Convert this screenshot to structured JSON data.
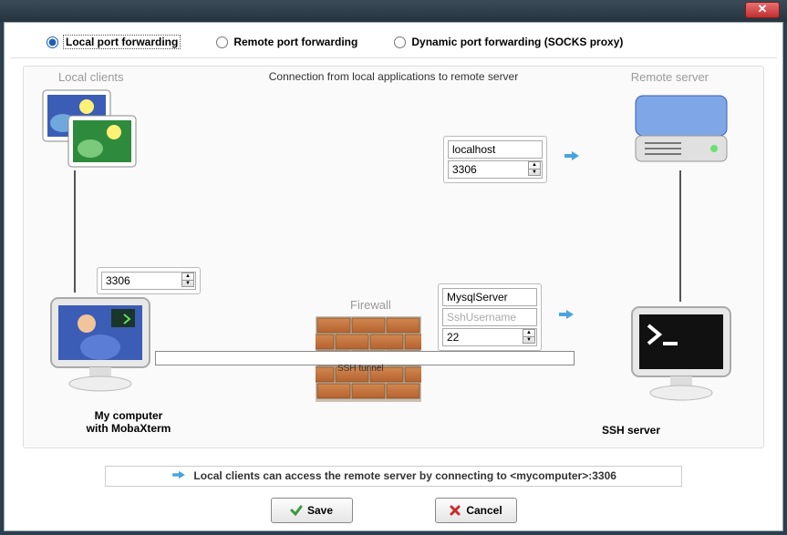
{
  "tabs": {
    "local": "Local port forwarding",
    "remote": "Remote port forwarding",
    "dynamic": "Dynamic port forwarding (SOCKS proxy)"
  },
  "diagram": {
    "caption": "Connection from local applications to remote server",
    "local_clients_label": "Local clients",
    "remote_server_label": "Remote server",
    "firewall_label": "Firewall",
    "ssh_tunnel_label": "SSH tunnel",
    "my_computer_line1": "My computer",
    "my_computer_line2": "with MobaXterm",
    "ssh_server_label": "SSH server"
  },
  "fields": {
    "local_port": "3306",
    "remote_host": "localhost",
    "remote_port": "3306",
    "ssh_server": "MysqlServer",
    "ssh_user_placeholder": "SshUsername",
    "ssh_port": "22"
  },
  "hint": "Local clients can access the remote server by connecting to <mycomputer>:3306",
  "buttons": {
    "save": "Save",
    "cancel": "Cancel"
  }
}
